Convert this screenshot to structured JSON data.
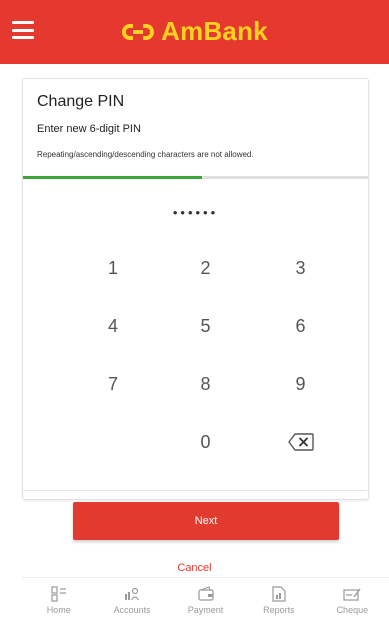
{
  "brand": {
    "name": "AmBank",
    "color": "#ffd21f",
    "bar_color": "#e5392f"
  },
  "card": {
    "title": "Change PIN",
    "subtitle": "Enter new 6-digit PIN",
    "hint": "Repeating/ascending/descending characters are not allowed.",
    "progress": 0.52,
    "pin_mask": "••••••"
  },
  "keypad": {
    "keys": [
      "1",
      "2",
      "3",
      "4",
      "5",
      "6",
      "7",
      "8",
      "9",
      "",
      "0",
      "backspace"
    ]
  },
  "actions": {
    "next_label": "Next",
    "cancel_label": "Cancel",
    "accent": "#e13b30"
  },
  "bottom_nav": {
    "items": [
      {
        "label": "Home",
        "icon": "home-icon"
      },
      {
        "label": "Accounts",
        "icon": "accounts-icon"
      },
      {
        "label": "Payment",
        "icon": "payment-icon"
      },
      {
        "label": "Reports",
        "icon": "reports-icon"
      },
      {
        "label": "Cheque",
        "icon": "cheque-icon"
      }
    ]
  }
}
